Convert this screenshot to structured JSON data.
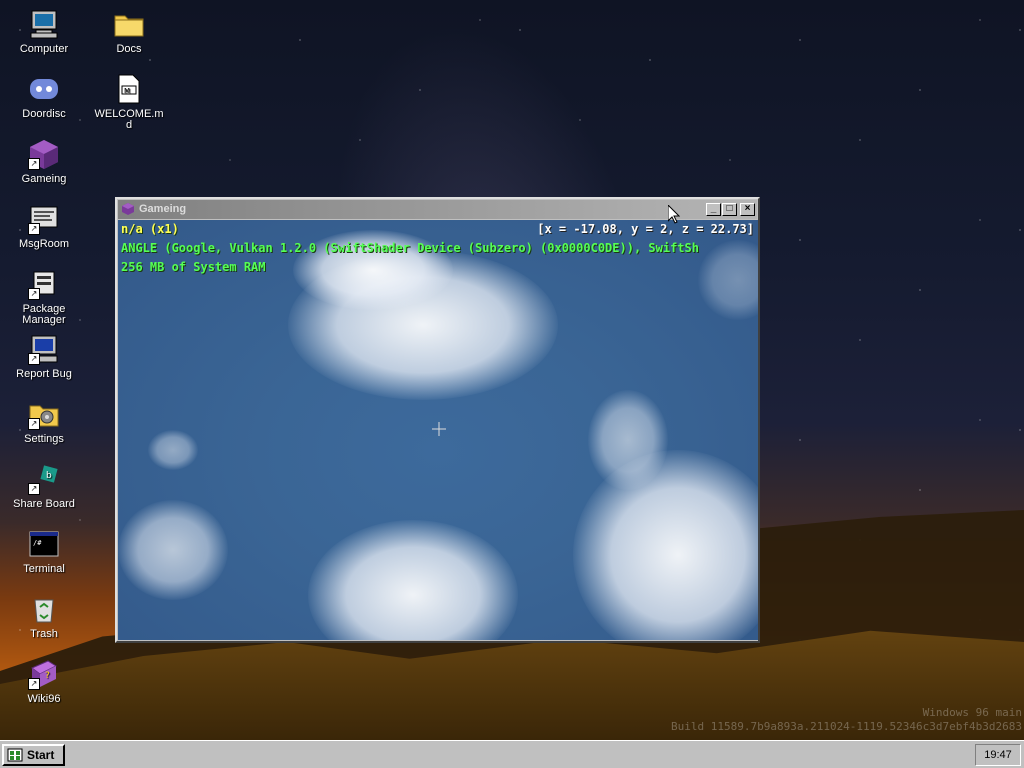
{
  "desktop": {
    "icons": [
      {
        "label": "Computer",
        "icon": "computer-icon"
      },
      {
        "label": "Docs",
        "icon": "folder-icon"
      },
      {
        "label": "Doordisc",
        "icon": "chat-app-icon"
      },
      {
        "label": "WELCOME.md",
        "icon": "markdown-file-icon"
      },
      {
        "label": "Gameing",
        "icon": "game-cube-icon"
      },
      {
        "label": "MsgRoom",
        "icon": "message-room-icon"
      },
      {
        "label": "Package Manager",
        "icon": "package-icon"
      },
      {
        "label": "Report Bug",
        "icon": "bug-report-icon"
      },
      {
        "label": "Settings",
        "icon": "settings-icon"
      },
      {
        "label": "Share Board",
        "icon": "share-board-icon"
      },
      {
        "label": "Terminal",
        "icon": "terminal-icon"
      },
      {
        "label": "Trash",
        "icon": "recycle-bin-icon"
      },
      {
        "label": "Wiki96",
        "icon": "wiki-book-icon"
      }
    ],
    "build_info": {
      "line1": "Windows 96 main",
      "line2": "Build 11589.7b9a893a.211024-1119.52346c3d7ebf4b3d2683"
    }
  },
  "window": {
    "title": "Gameing",
    "buttons": {
      "minimize": "_",
      "maximize": "□",
      "close": "×"
    },
    "hud": {
      "version": "n/a (x1)",
      "coords": "[x = -17.08, y = 2, z = 22.73]",
      "renderer": "ANGLE (Google, Vulkan 1.2.0 (SwiftShader Device (Subzero) (0x0000C0DE)), SwiftSh",
      "ram": "256 MB of System RAM"
    }
  },
  "taskbar": {
    "start_label": "Start",
    "clock": "19:47"
  },
  "colors": {
    "hud_yellow": "#ffff55",
    "hud_green": "#55ff55",
    "sky_blue": "#3a6595",
    "window_gray": "#c0c0c0"
  }
}
